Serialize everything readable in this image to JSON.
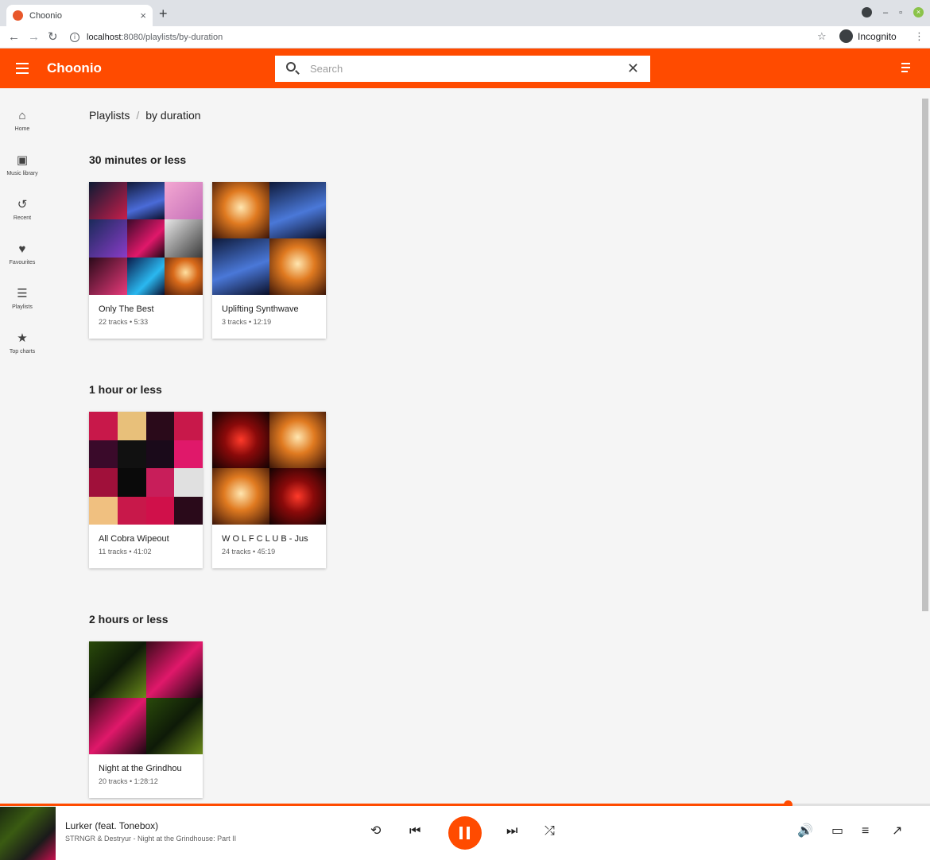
{
  "browser": {
    "tab_title": "Choonio",
    "tab_close": "×",
    "new_tab": "+",
    "url_host": "localhost",
    "url_rest": ":8080/playlists/by-duration",
    "incognito_label": "Incognito"
  },
  "app": {
    "title": "Choonio",
    "search_placeholder": "Search",
    "accent": "#ff4b00"
  },
  "sidebar": {
    "items": [
      {
        "label": "Home",
        "icon": "home-icon"
      },
      {
        "label": "Music library",
        "icon": "library-icon"
      },
      {
        "label": "Recent",
        "icon": "history-icon"
      },
      {
        "label": "Favourites",
        "icon": "heart-icon"
      },
      {
        "label": "Playlists",
        "icon": "list-icon"
      },
      {
        "label": "Top charts",
        "icon": "star-icon"
      }
    ]
  },
  "breadcrumb": {
    "root": "Playlists",
    "separator": "/",
    "current": "by duration"
  },
  "sections": [
    {
      "title": "30 minutes or less",
      "playlists": [
        {
          "name": "Only The Best",
          "meta": "22 tracks • 5:33"
        },
        {
          "name": "Uplifting Synthwave",
          "meta": "3 tracks • 12:19"
        }
      ]
    },
    {
      "title": "1 hour or less",
      "playlists": [
        {
          "name": "All Cobra Wipeout",
          "meta": "11 tracks • 41:02"
        },
        {
          "name": "W O L F C L U B - Jus",
          "meta": "24 tracks • 45:19"
        }
      ]
    },
    {
      "title": "2 hours or less",
      "playlists": [
        {
          "name": "Night at the Grindhou",
          "meta": "20 tracks • 1:28:12"
        }
      ]
    }
  ],
  "player": {
    "track_title": "Lurker (feat. Tonebox)",
    "track_artist": "STRNGR & Destryur - Night at the Grindhouse: Part II",
    "progress_fraction": 0.847
  }
}
